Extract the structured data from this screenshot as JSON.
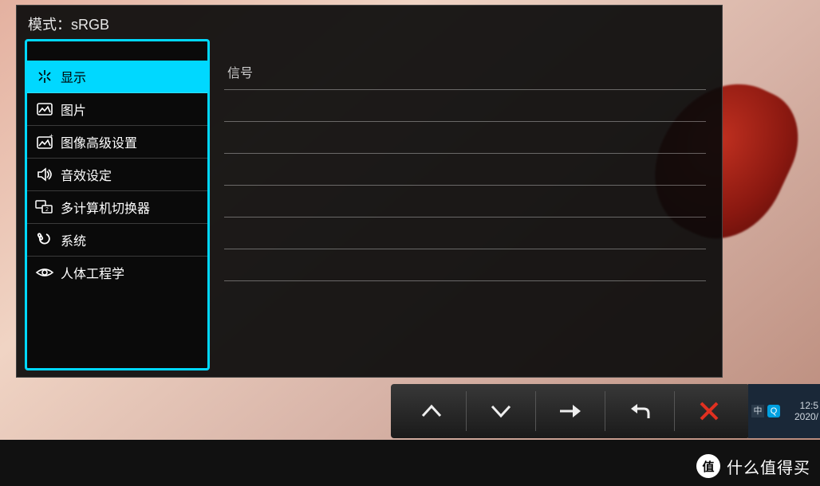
{
  "osd": {
    "title": "模式：sRGB",
    "menu": [
      {
        "label": "显示",
        "icon": "display-icon",
        "selected": true
      },
      {
        "label": "图片",
        "icon": "picture-icon",
        "selected": false
      },
      {
        "label": "图像高级设置",
        "icon": "picture-advanced-icon",
        "selected": false
      },
      {
        "label": "音效设定",
        "icon": "audio-icon",
        "selected": false
      },
      {
        "label": "多计算机切换器",
        "icon": "kvm-icon",
        "selected": false
      },
      {
        "label": "系统",
        "icon": "system-icon",
        "selected": false
      },
      {
        "label": "人体工程学",
        "icon": "ergonomics-icon",
        "selected": false
      }
    ],
    "detail_header": "信号"
  },
  "nav_buttons": {
    "up": "up-button",
    "down": "down-button",
    "enter": "enter-button",
    "back": "back-button",
    "exit": "exit-button"
  },
  "taskbar": {
    "ime": "中",
    "app": "Q",
    "time": "12:5",
    "date": "2020/"
  },
  "watermark": {
    "badge": "值",
    "text": "什么值得买"
  }
}
